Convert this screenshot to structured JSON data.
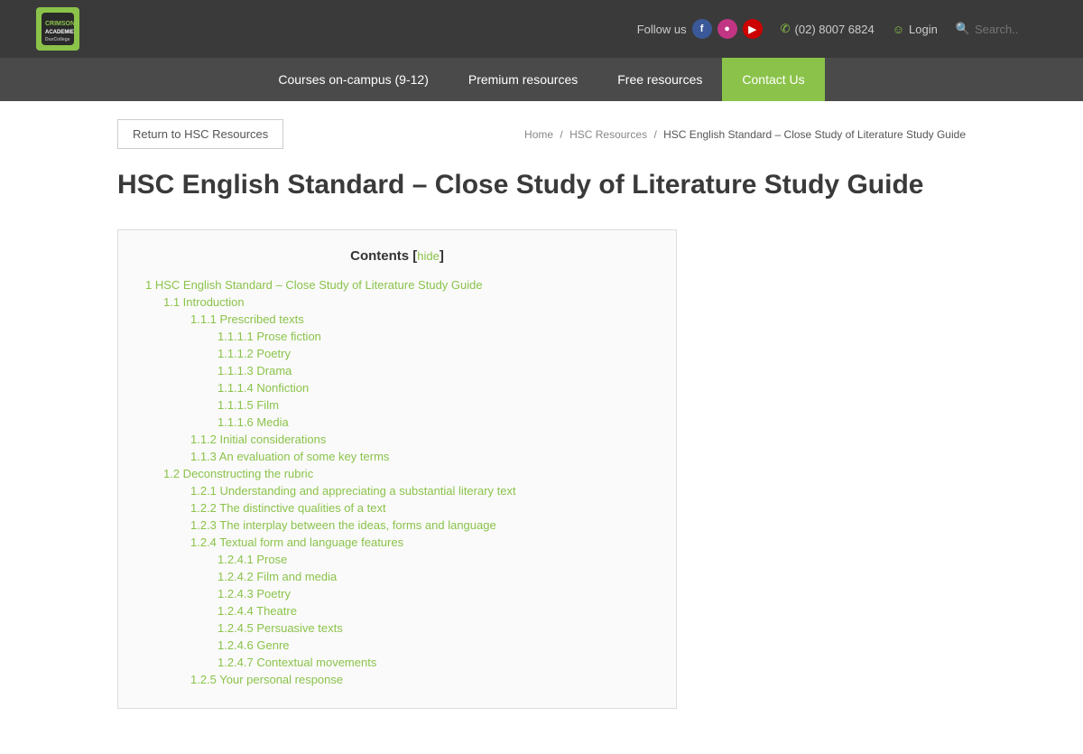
{
  "header": {
    "logo_main": "CRIMSON",
    "logo_sub": "ACADEMIES",
    "logo_sub2": "DuxCollege",
    "follow_label": "Follow us",
    "phone": "(02) 8007 6824",
    "login_label": "Login",
    "search_placeholder": "Search..",
    "nav_items": [
      {
        "label": "Courses on-campus (9-12)",
        "key": "courses"
      },
      {
        "label": "Premium resources",
        "key": "premium"
      },
      {
        "label": "Free resources",
        "key": "free"
      },
      {
        "label": "Contact Us",
        "key": "contact"
      }
    ]
  },
  "breadcrumb": {
    "home": "Home",
    "hsc": "HSC Resources",
    "current": "HSC English Standard – Close Study of Literature Study Guide"
  },
  "back_button": "Return to HSC Resources",
  "page_title": "HSC English Standard – Close Study of Literature Study Guide",
  "contents": {
    "header": "Contents",
    "hide_label": "hide",
    "items": [
      {
        "level": 0,
        "text": "1 HSC English Standard – Close Study of Literature Study Guide",
        "href": "#"
      },
      {
        "level": 1,
        "text": "1.1 Introduction",
        "href": "#"
      },
      {
        "level": 2,
        "text": "1.1.1 Prescribed texts",
        "href": "#"
      },
      {
        "level": 3,
        "text": "1.1.1.1 Prose fiction",
        "href": "#"
      },
      {
        "level": 3,
        "text": "1.1.1.2 Poetry",
        "href": "#"
      },
      {
        "level": 3,
        "text": "1.1.1.3 Drama",
        "href": "#"
      },
      {
        "level": 3,
        "text": "1.1.1.4 Nonfiction",
        "href": "#"
      },
      {
        "level": 3,
        "text": "1.1.1.5 Film",
        "href": "#"
      },
      {
        "level": 3,
        "text": "1.1.1.6 Media",
        "href": "#"
      },
      {
        "level": 2,
        "text": "1.1.2 Initial considerations",
        "href": "#"
      },
      {
        "level": 2,
        "text": "1.1.3 An evaluation of some key terms",
        "href": "#"
      },
      {
        "level": 1,
        "text": "1.2 Deconstructing the rubric",
        "href": "#"
      },
      {
        "level": 2,
        "text": "1.2.1 Understanding and appreciating a substantial literary text",
        "href": "#"
      },
      {
        "level": 2,
        "text": "1.2.2 The distinctive qualities of a text",
        "href": "#"
      },
      {
        "level": 2,
        "text": "1.2.3 The interplay between the ideas, forms and language",
        "href": "#"
      },
      {
        "level": 2,
        "text": "1.2.4 Textual form and language features",
        "href": "#"
      },
      {
        "level": 3,
        "text": "1.2.4.1 Prose",
        "href": "#"
      },
      {
        "level": 3,
        "text": "1.2.4.2 Film and media",
        "href": "#"
      },
      {
        "level": 3,
        "text": "1.2.4.3 Poetry",
        "href": "#"
      },
      {
        "level": 3,
        "text": "1.2.4.4 Theatre",
        "href": "#"
      },
      {
        "level": 3,
        "text": "1.2.4.5 Persuasive texts",
        "href": "#"
      },
      {
        "level": 3,
        "text": "1.2.4.6 Genre",
        "href": "#"
      },
      {
        "level": 3,
        "text": "1.2.4.7 Contextual movements",
        "href": "#"
      },
      {
        "level": 2,
        "text": "1.2.5 Your personal response",
        "href": "#"
      }
    ]
  }
}
